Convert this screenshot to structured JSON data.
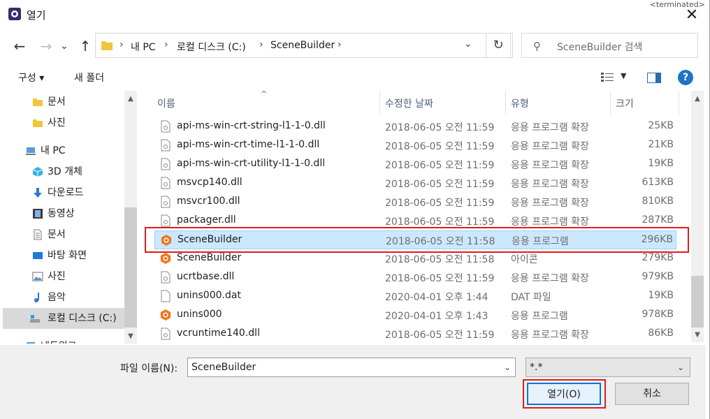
{
  "window": {
    "title": "열기",
    "close_glyph": "✕",
    "background_text": "<terminated>"
  },
  "nav": {
    "back_glyph": "←",
    "forward_glyph": "→",
    "recent_glyph": "⌄",
    "up_glyph": "↑",
    "breadcrumb": [
      "내 PC",
      "로컬 디스크 (C:)",
      "SceneBuilder"
    ],
    "refresh_glyph": "↻",
    "search_placeholder": "SceneBuilder 검색"
  },
  "toolbar": {
    "organize": "구성 ▾",
    "new_folder": "새 폴더",
    "help": "?"
  },
  "sidebar": {
    "items": [
      {
        "label": "문서",
        "icon": "folder-icon"
      },
      {
        "label": "사진",
        "icon": "folder-icon"
      },
      {
        "label": "내 PC",
        "icon": "pc-icon"
      },
      {
        "label": "3D 개체",
        "icon": "3d-objects-icon"
      },
      {
        "label": "다운로드",
        "icon": "download-icon"
      },
      {
        "label": "동영상",
        "icon": "video-icon"
      },
      {
        "label": "문서",
        "icon": "document-icon"
      },
      {
        "label": "바탕 화면",
        "icon": "desktop-icon"
      },
      {
        "label": "사진",
        "icon": "picture-icon"
      },
      {
        "label": "음악",
        "icon": "music-icon"
      },
      {
        "label": "로컬 디스크 (C:)",
        "icon": "drive-icon"
      },
      {
        "label": "네트워크",
        "icon": "network-icon"
      }
    ]
  },
  "list": {
    "columns": {
      "name": "이름",
      "date": "수정한 날짜",
      "type": "유형",
      "size": "크기"
    },
    "rows": [
      {
        "name": "api-ms-win-crt-string-l1-1-0.dll",
        "date": "2018-06-05 오전 11:59",
        "type": "응용 프로그램 확장",
        "size": "25KB",
        "icon": "dll-file-icon"
      },
      {
        "name": "api-ms-win-crt-time-l1-1-0.dll",
        "date": "2018-06-05 오전 11:59",
        "type": "응용 프로그램 확장",
        "size": "21KB",
        "icon": "dll-file-icon"
      },
      {
        "name": "api-ms-win-crt-utility-l1-1-0.dll",
        "date": "2018-06-05 오전 11:59",
        "type": "응용 프로그램 확장",
        "size": "19KB",
        "icon": "dll-file-icon"
      },
      {
        "name": "msvcp140.dll",
        "date": "2018-06-05 오전 11:59",
        "type": "응용 프로그램 확장",
        "size": "613KB",
        "icon": "dll-file-icon"
      },
      {
        "name": "msvcr100.dll",
        "date": "2018-06-05 오전 11:59",
        "type": "응용 프로그램 확장",
        "size": "810KB",
        "icon": "dll-file-icon"
      },
      {
        "name": "packager.dll",
        "date": "2018-06-05 오전 11:59",
        "type": "응용 프로그램 확장",
        "size": "287KB",
        "icon": "dll-file-icon"
      },
      {
        "name": "SceneBuilder",
        "date": "2018-06-05 오전 11:58",
        "type": "응용 프로그램",
        "size": "296KB",
        "icon": "scenebuilder-app-icon",
        "selected": true
      },
      {
        "name": "SceneBuilder",
        "date": "2018-06-05 오전 11:58",
        "type": "아이콘",
        "size": "279KB",
        "icon": "scenebuilder-app-icon"
      },
      {
        "name": "ucrtbase.dll",
        "date": "2018-06-05 오전 11:59",
        "type": "응용 프로그램 확장",
        "size": "979KB",
        "icon": "dll-file-icon"
      },
      {
        "name": "unins000.dat",
        "date": "2020-04-01 오후 1:44",
        "type": "DAT 파일",
        "size": "19KB",
        "icon": "blank-file-icon"
      },
      {
        "name": "unins000",
        "date": "2020-04-01 오후 1:43",
        "type": "응용 프로그램",
        "size": "978KB",
        "icon": "scenebuilder-app-icon"
      },
      {
        "name": "vcruntime140.dll",
        "date": "2018-06-05 오전 11:59",
        "type": "응용 프로그램 확장",
        "size": "86KB",
        "icon": "dll-file-icon"
      }
    ]
  },
  "footer": {
    "filename_label": "파일 이름(N):",
    "filename_value": "SceneBuilder",
    "filetype_value": "*.*",
    "open_button": "열기(O)",
    "cancel_button": "취소"
  },
  "colors": {
    "selection": "#cce8ff",
    "highlight": "#e01b1b",
    "accent": "#0078d7"
  }
}
